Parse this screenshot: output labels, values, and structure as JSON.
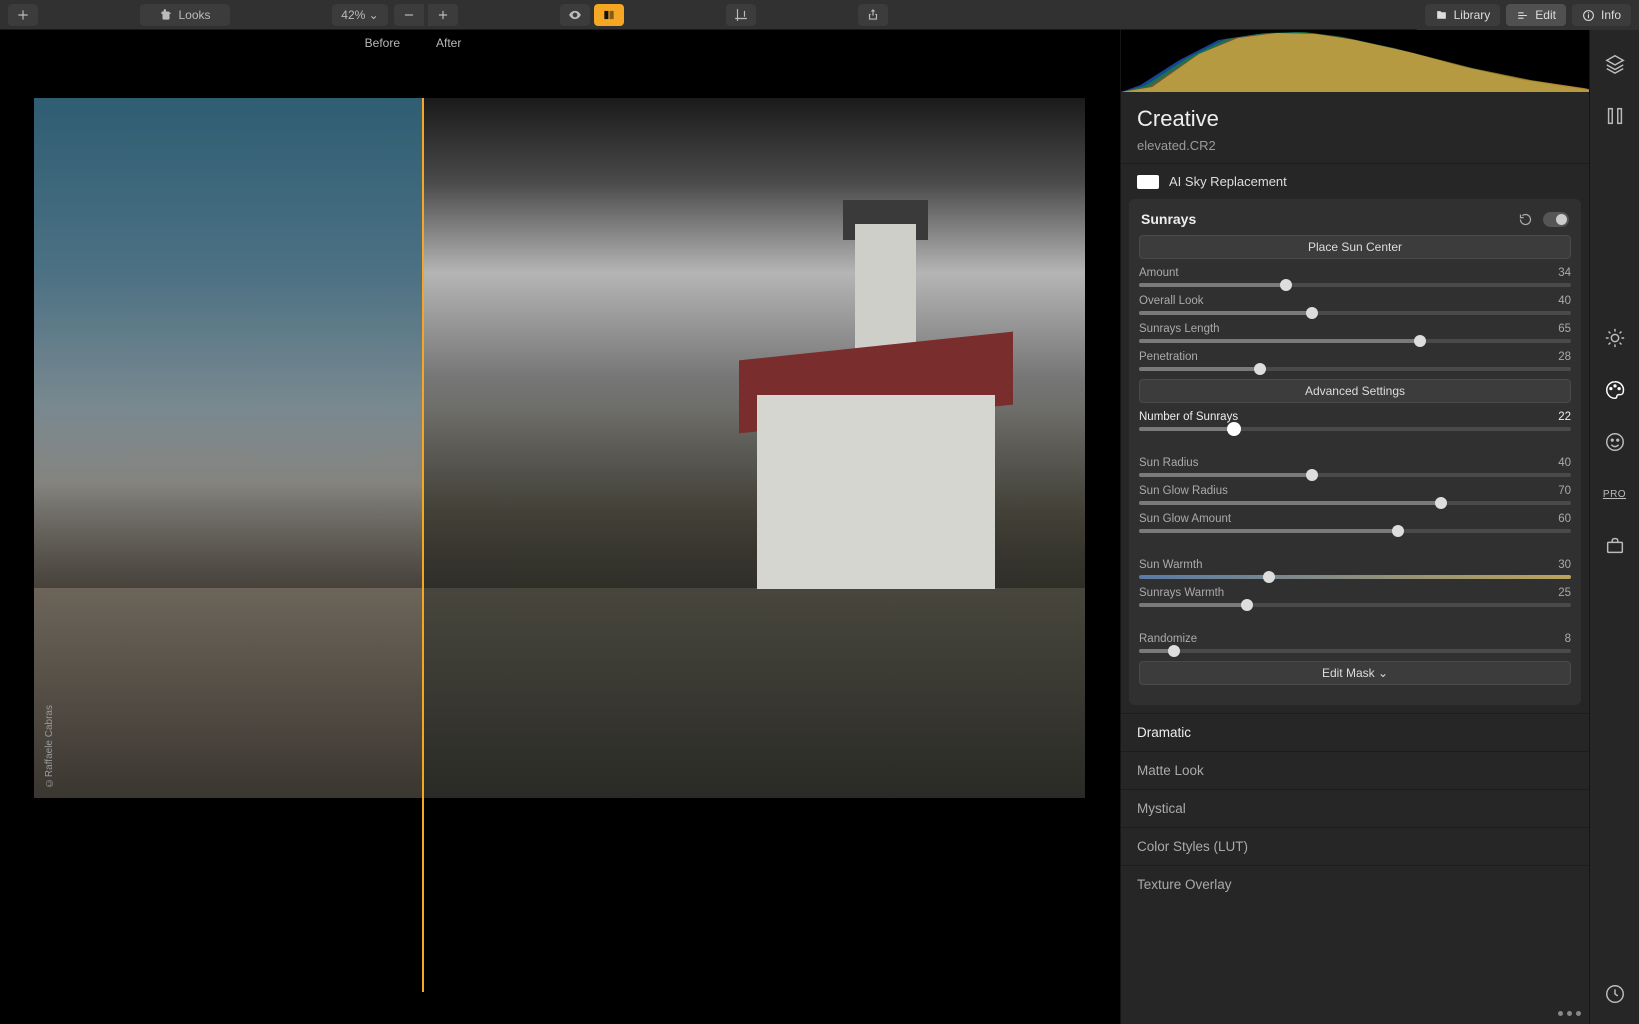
{
  "toolbar": {
    "looks_label": "Looks",
    "zoom_label": "42% ⌄"
  },
  "modes": {
    "library": "Library",
    "edit": "Edit",
    "info": "Info"
  },
  "viewport": {
    "before_label": "Before",
    "after_label": "After",
    "credit": "©Raffaele Cabras"
  },
  "panel": {
    "section_title": "Creative",
    "filename": "elevated.CR2",
    "sky_replace_label": "AI Sky Replacement"
  },
  "tool": {
    "name": "Sunrays",
    "place_btn": "Place Sun Center",
    "advanced_btn": "Advanced Settings",
    "edit_mask_btn": "Edit Mask ⌄",
    "sliders": {
      "amount": {
        "label": "Amount",
        "value": 34,
        "max": 100
      },
      "overall_look": {
        "label": "Overall Look",
        "value": 40,
        "max": 100
      },
      "length": {
        "label": "Sunrays Length",
        "value": 65,
        "max": 100
      },
      "penetration": {
        "label": "Penetration",
        "value": 28,
        "max": 100
      },
      "num_rays": {
        "label": "Number of Sunrays",
        "value": 22,
        "max": 100
      },
      "sun_radius": {
        "label": "Sun Radius",
        "value": 40,
        "max": 100
      },
      "glow_radius": {
        "label": "Sun Glow Radius",
        "value": 70,
        "max": 100
      },
      "glow_amount": {
        "label": "Sun Glow Amount",
        "value": 60,
        "max": 100
      },
      "sun_warmth": {
        "label": "Sun Warmth",
        "value": 30,
        "max": 100
      },
      "rays_warmth": {
        "label": "Sunrays Warmth",
        "value": 25,
        "max": 100
      },
      "randomize": {
        "label": "Randomize",
        "value": 8,
        "max": 100
      }
    }
  },
  "filters": {
    "dramatic": "Dramatic",
    "matte": "Matte Look",
    "mystical": "Mystical",
    "color_styles": "Color Styles (LUT)",
    "texture": "Texture Overlay"
  },
  "iconstrip": {
    "pro": "PRO"
  }
}
